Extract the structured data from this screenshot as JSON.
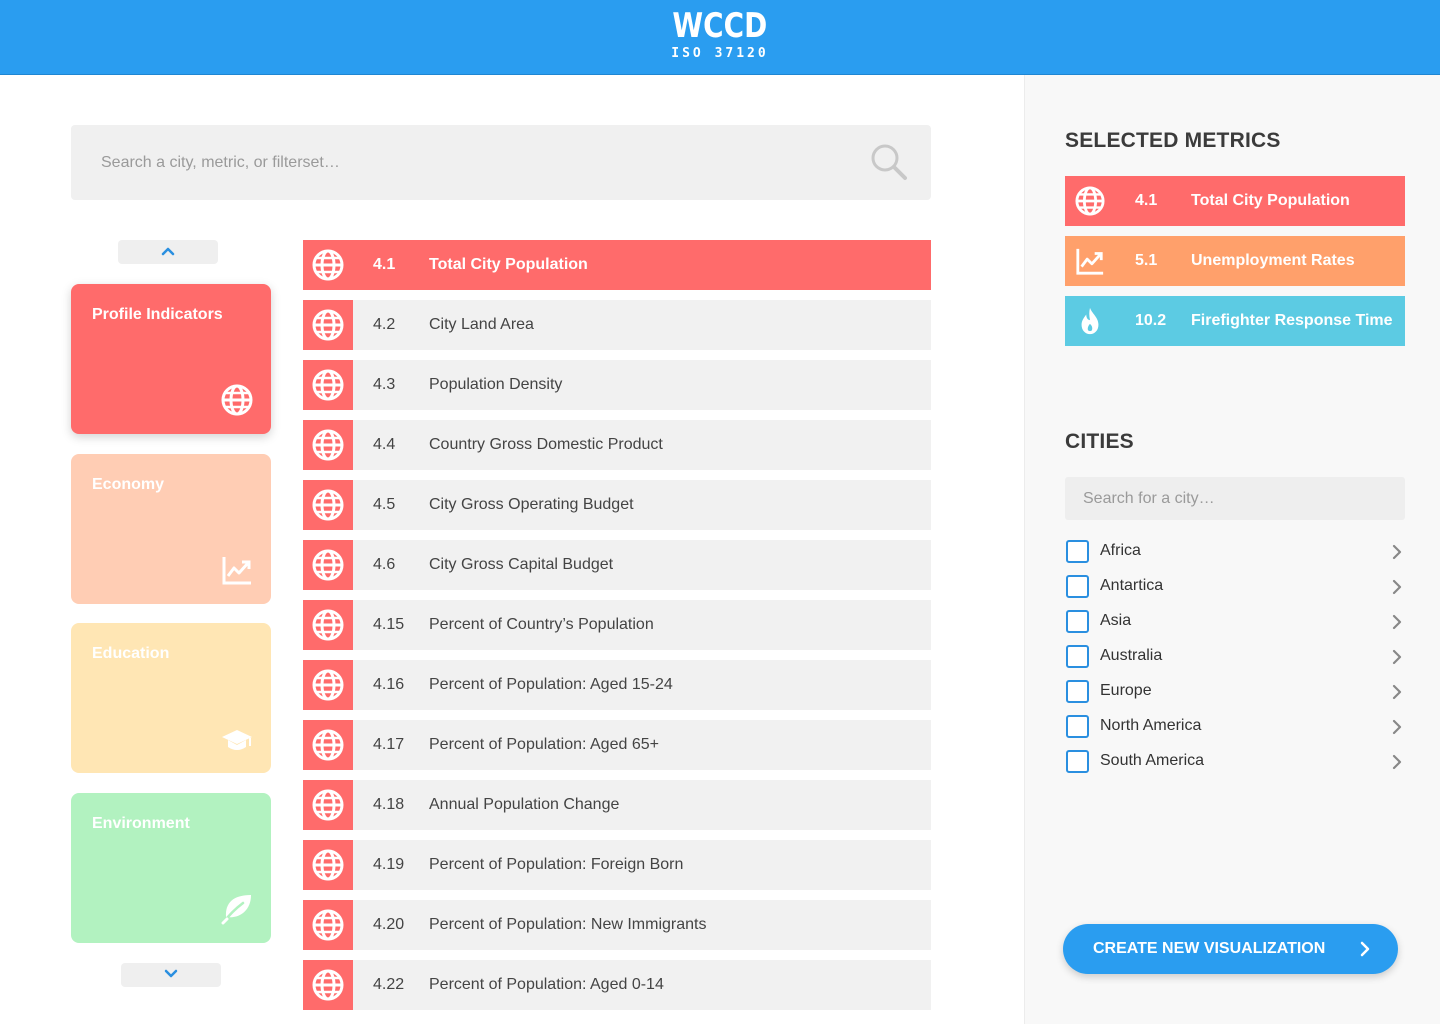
{
  "header": {
    "title": "WCCD",
    "subtitle": "ISO 37120"
  },
  "search": {
    "placeholder": "Search a city, metric, or filterset…"
  },
  "categories": [
    {
      "label": "Profile Indicators",
      "color": "#ff6b6b",
      "icon": "globe-icon",
      "active": true
    },
    {
      "label": "Economy",
      "color": "#ffcdb4",
      "icon": "trend-chart-icon",
      "active": false
    },
    {
      "label": "Education",
      "color": "#ffe6b4",
      "icon": "graduation-cap-icon",
      "active": false
    },
    {
      "label": "Environment",
      "color": "#b2f2c0",
      "icon": "leaf-icon",
      "active": false
    }
  ],
  "metrics": [
    {
      "num": "4.1",
      "label": "Total City Population",
      "selected": true
    },
    {
      "num": "4.2",
      "label": "City Land Area",
      "selected": false
    },
    {
      "num": "4.3",
      "label": "Population Density",
      "selected": false
    },
    {
      "num": "4.4",
      "label": "Country Gross Domestic Product",
      "selected": false
    },
    {
      "num": "4.5",
      "label": "City Gross Operating Budget",
      "selected": false
    },
    {
      "num": "4.6",
      "label": "City Gross Capital Budget",
      "selected": false
    },
    {
      "num": "4.15",
      "label": "Percent of Country’s Population",
      "selected": false
    },
    {
      "num": "4.16",
      "label": "Percent of Population: Aged 15-24",
      "selected": false
    },
    {
      "num": "4.17",
      "label": "Percent of Population: Aged 65+",
      "selected": false
    },
    {
      "num": "4.18",
      "label": "Annual Population Change",
      "selected": false
    },
    {
      "num": "4.19",
      "label": "Percent of Population: Foreign Born",
      "selected": false
    },
    {
      "num": "4.20",
      "label": "Percent of Population: New Immigrants",
      "selected": false
    },
    {
      "num": "4.22",
      "label": "Percent of Population: Aged 0-14",
      "selected": false
    }
  ],
  "selected_metrics": {
    "title": "SELECTED METRICS",
    "items": [
      {
        "num": "4.1",
        "label": "Total City Population",
        "color": "#ff6b6b",
        "icon": "globe-icon"
      },
      {
        "num": "5.1",
        "label": "Unemployment Rates",
        "color": "#ffa06b",
        "icon": "trend-chart-icon"
      },
      {
        "num": "10.2",
        "label": "Firefighter Response Time",
        "color": "#5ccbe3",
        "icon": "flame-icon"
      }
    ]
  },
  "cities": {
    "title": "CITIES",
    "placeholder": "Search for a city…",
    "regions": [
      "Africa",
      "Antartica",
      "Asia",
      "Australia",
      "Europe",
      "North America",
      "South America"
    ]
  },
  "create_button": {
    "label": "CREATE NEW VISUALIZATION"
  },
  "colors": {
    "accent": "#2a9df0",
    "profile": "#ff6b6b"
  }
}
